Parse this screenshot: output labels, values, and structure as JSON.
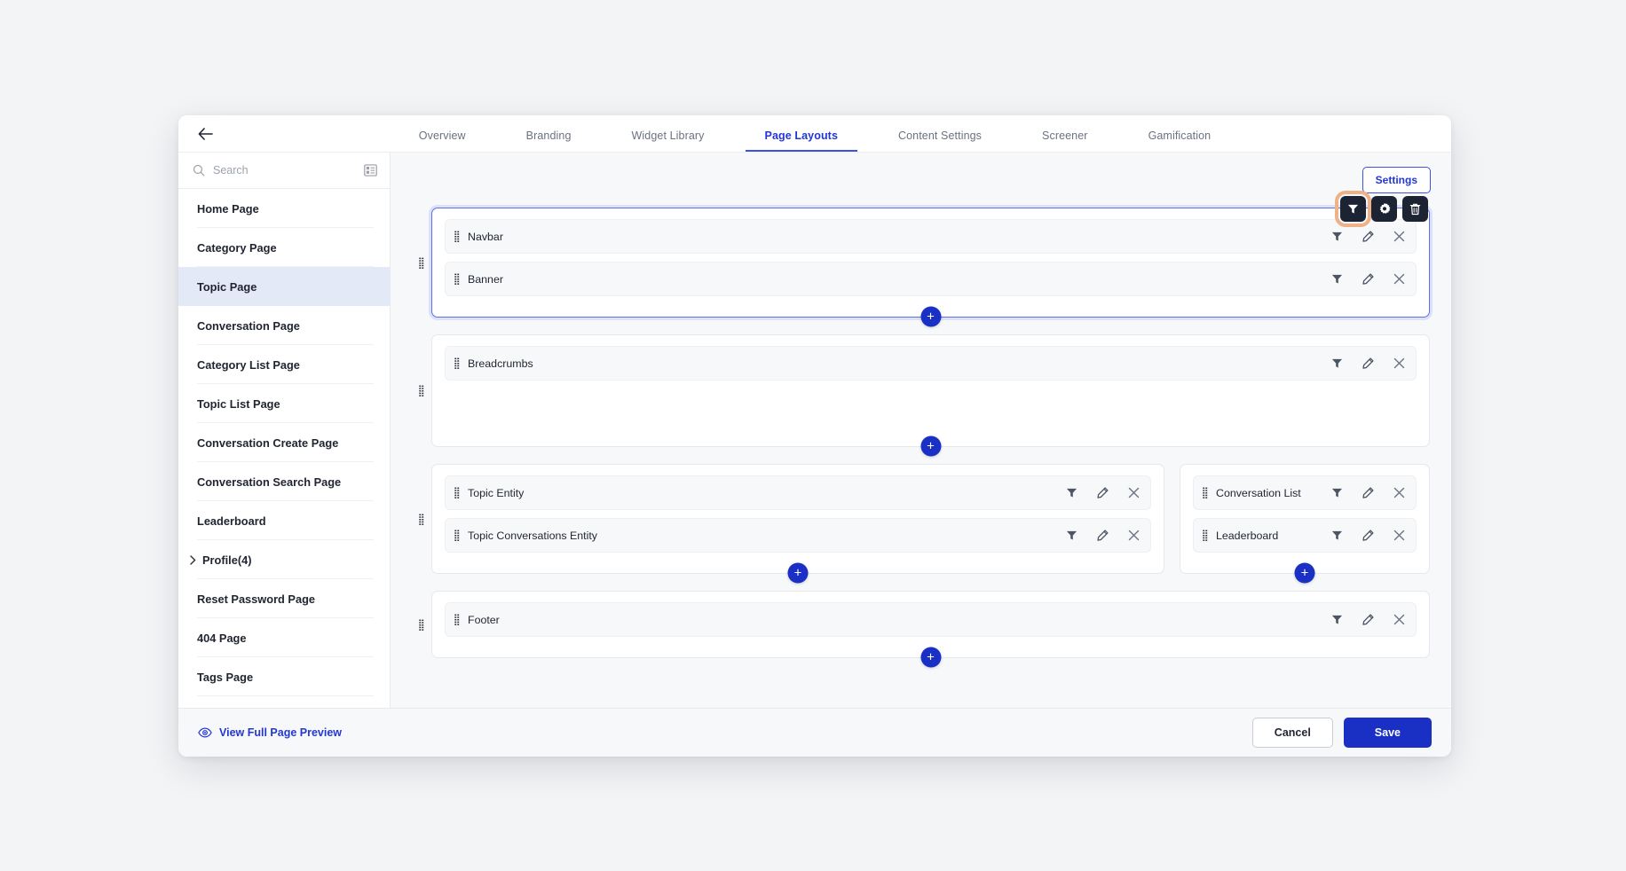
{
  "window": {
    "back_icon": "arrow-left-icon"
  },
  "tabs": [
    {
      "label": "Overview",
      "active": false
    },
    {
      "label": "Branding",
      "active": false
    },
    {
      "label": "Widget Library",
      "active": false
    },
    {
      "label": "Page Layouts",
      "active": true
    },
    {
      "label": "Content Settings",
      "active": false
    },
    {
      "label": "Screener",
      "active": false
    },
    {
      "label": "Gamification",
      "active": false
    }
  ],
  "sidebar": {
    "search": {
      "placeholder": "Search",
      "value": "",
      "icon": "search-icon"
    },
    "panel_toggle_icon": "layout-panel-icon",
    "items": [
      {
        "label": "Home Page",
        "selected": false,
        "expandable": false
      },
      {
        "label": "Category Page",
        "selected": false,
        "expandable": false
      },
      {
        "label": "Topic Page",
        "selected": true,
        "expandable": false
      },
      {
        "label": "Conversation Page",
        "selected": false,
        "expandable": false
      },
      {
        "label": "Category List Page",
        "selected": false,
        "expandable": false
      },
      {
        "label": "Topic List Page",
        "selected": false,
        "expandable": false
      },
      {
        "label": "Conversation Create Page",
        "selected": false,
        "expandable": false
      },
      {
        "label": "Conversation Search Page",
        "selected": false,
        "expandable": false
      },
      {
        "label": "Leaderboard",
        "selected": false,
        "expandable": false
      },
      {
        "label": "Profile(4)",
        "selected": false,
        "expandable": true
      },
      {
        "label": "Reset Password Page",
        "selected": false,
        "expandable": false
      },
      {
        "label": "404 Page",
        "selected": false,
        "expandable": false
      },
      {
        "label": "Tags Page",
        "selected": false,
        "expandable": false
      }
    ]
  },
  "canvas": {
    "settings_button": "Settings",
    "toolbar": [
      {
        "name": "filter-icon",
        "highlighted": true
      },
      {
        "name": "gear-icon",
        "highlighted": false
      },
      {
        "name": "trash-icon",
        "highlighted": false
      }
    ],
    "add_button_label": "+",
    "row_action_icons": [
      "filter-icon",
      "pencil-icon",
      "close-icon"
    ],
    "sections": [
      {
        "selected": true,
        "columns": [
          {
            "widgets": [
              {
                "label": "Navbar"
              },
              {
                "label": "Banner"
              }
            ]
          }
        ]
      },
      {
        "selected": false,
        "tall": true,
        "columns": [
          {
            "widgets": [
              {
                "label": "Breadcrumbs"
              }
            ]
          }
        ]
      },
      {
        "selected": false,
        "columns": [
          {
            "widgets": [
              {
                "label": "Topic Entity"
              },
              {
                "label": "Topic Conversations Entity"
              }
            ]
          },
          {
            "widgets": [
              {
                "label": "Conversation List"
              },
              {
                "label": "Leaderboard"
              }
            ]
          }
        ]
      },
      {
        "selected": false,
        "columns": [
          {
            "widgets": [
              {
                "label": "Footer"
              }
            ]
          }
        ]
      }
    ]
  },
  "footer": {
    "preview_link": "View Full Page Preview",
    "preview_icon": "eye-icon",
    "cancel_label": "Cancel",
    "save_label": "Save"
  },
  "colors": {
    "accent_blue": "#1a2fc4",
    "tab_active": "#2337d4",
    "selected_nav_bg": "#e4e9f7",
    "highlight_orange": "#edb287",
    "dark_button": "#1c2333"
  }
}
